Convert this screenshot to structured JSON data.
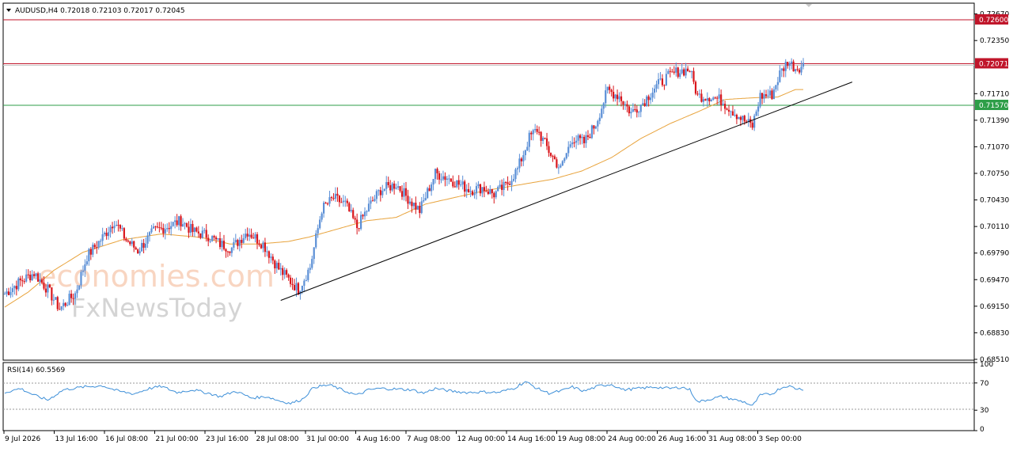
{
  "header": {
    "symbol": "AUDUSD,H4",
    "ohlc": "0.72018 0.72103 0.72017 0.72045"
  },
  "rsi_header": "RSI(14) 60.5569",
  "watermark": {
    "line1": "economies.com",
    "line2": "FxNewsToday"
  },
  "colors": {
    "bull": "#5b8fd6",
    "bear": "#d9161c",
    "ma": "#e8a33c",
    "resistance": "#c0152a",
    "support": "#2e9e48",
    "trendline": "#000000",
    "rsi": "#3d8fd8"
  },
  "chart_data": [
    {
      "type": "candlestick",
      "ylim": [
        0.685,
        0.728
      ],
      "y_ticks": [
        "0.72670",
        "0.72600",
        "0.72350",
        "0.72071",
        "0.71710",
        "0.71570",
        "0.71390",
        "0.71070",
        "0.70750",
        "0.70430",
        "0.70110",
        "0.69790",
        "0.69470",
        "0.69150",
        "0.68830",
        "0.68510"
      ],
      "x_labels": [
        "9 Jul 2026",
        "13 Jul 16:00",
        "16 Jul 08:00",
        "21 Jul 00:00",
        "23 Jul 16:00",
        "28 Jul 08:00",
        "31 Jul 00:00",
        "4 Aug 16:00",
        "7 Aug 08:00",
        "12 Aug 00:00",
        "14 Aug 16:00",
        "19 Aug 08:00",
        "24 Aug 00:00",
        "26 Aug 16:00",
        "31 Aug 08:00",
        "3 Sep 00:00"
      ],
      "levels": [
        {
          "value": 0.726,
          "label": "0.72600",
          "kind": "resistance"
        },
        {
          "value": 0.72071,
          "label": "0.72071",
          "kind": "current"
        },
        {
          "value": 0.7157,
          "label": "0.71570",
          "kind": "support"
        }
      ],
      "trendline": {
        "from": [
          "28 Jul 08:00",
          0.6922
        ],
        "to": [
          "after 3 Sep 00:00",
          0.7185
        ]
      },
      "moving_average_anchors": [
        [
          0,
          0.6914
        ],
        [
          12,
          0.6932
        ],
        [
          25,
          0.6958
        ],
        [
          40,
          0.698
        ],
        [
          60,
          0.6995
        ],
        [
          80,
          0.7002
        ],
        [
          100,
          0.6998
        ],
        [
          115,
          0.699
        ],
        [
          130,
          0.699
        ],
        [
          145,
          0.6993
        ],
        [
          155,
          0.6998
        ],
        [
          170,
          0.7008
        ],
        [
          185,
          0.7018
        ],
        [
          200,
          0.7022
        ],
        [
          215,
          0.7038
        ],
        [
          230,
          0.7046
        ],
        [
          245,
          0.7054
        ],
        [
          260,
          0.706
        ],
        [
          280,
          0.7068
        ],
        [
          295,
          0.7078
        ],
        [
          310,
          0.7094
        ],
        [
          325,
          0.7117
        ],
        [
          340,
          0.7135
        ],
        [
          355,
          0.715
        ],
        [
          368,
          0.7164
        ],
        [
          382,
          0.7166
        ],
        [
          395,
          0.7167
        ],
        [
          404,
          0.7176
        ]
      ],
      "price_anchors": [
        [
          0,
          0.693
        ],
        [
          8,
          0.6945
        ],
        [
          15,
          0.6955
        ],
        [
          22,
          0.6935
        ],
        [
          28,
          0.6912
        ],
        [
          36,
          0.693
        ],
        [
          42,
          0.6975
        ],
        [
          50,
          0.6998
        ],
        [
          56,
          0.7018
        ],
        [
          62,
          0.6995
        ],
        [
          68,
          0.6982
        ],
        [
          76,
          0.7005
        ],
        [
          84,
          0.7012
        ],
        [
          90,
          0.7018
        ],
        [
          96,
          0.7005
        ],
        [
          104,
          0.7
        ],
        [
          110,
          0.699
        ],
        [
          116,
          0.6985
        ],
        [
          124,
          0.7005
        ],
        [
          132,
          0.699
        ],
        [
          140,
          0.696
        ],
        [
          146,
          0.6945
        ],
        [
          150,
          0.6935
        ],
        [
          156,
          0.6962
        ],
        [
          162,
          0.7032
        ],
        [
          168,
          0.7045
        ],
        [
          174,
          0.7038
        ],
        [
          180,
          0.701
        ],
        [
          186,
          0.7035
        ],
        [
          192,
          0.7055
        ],
        [
          200,
          0.7062
        ],
        [
          206,
          0.7045
        ],
        [
          212,
          0.703
        ],
        [
          220,
          0.7075
        ],
        [
          226,
          0.707
        ],
        [
          232,
          0.7062
        ],
        [
          238,
          0.7055
        ],
        [
          244,
          0.7058
        ],
        [
          250,
          0.705
        ],
        [
          256,
          0.706
        ],
        [
          262,
          0.708
        ],
        [
          268,
          0.7118
        ],
        [
          272,
          0.7128
        ],
        [
          278,
          0.7102
        ],
        [
          284,
          0.708
        ],
        [
          290,
          0.7118
        ],
        [
          296,
          0.7112
        ],
        [
          302,
          0.7135
        ],
        [
          308,
          0.7175
        ],
        [
          314,
          0.7168
        ],
        [
          320,
          0.7148
        ],
        [
          326,
          0.716
        ],
        [
          332,
          0.7178
        ],
        [
          338,
          0.719
        ],
        [
          344,
          0.7198
        ],
        [
          350,
          0.72
        ],
        [
          354,
          0.7168
        ],
        [
          360,
          0.7168
        ],
        [
          366,
          0.7163
        ],
        [
          372,
          0.715
        ],
        [
          378,
          0.7138
        ],
        [
          382,
          0.7132
        ],
        [
          386,
          0.7168
        ],
        [
          392,
          0.717
        ],
        [
          396,
          0.7195
        ],
        [
          400,
          0.721
        ],
        [
          404,
          0.7202
        ],
        [
          408,
          0.7205
        ]
      ]
    },
    {
      "type": "line",
      "title": "RSI(14) 60.5569",
      "ylim": [
        0,
        100
      ],
      "y_ticks": [
        "100",
        "70",
        "30",
        "0"
      ],
      "levels": [
        70,
        30
      ],
      "anchors": [
        [
          0,
          56
        ],
        [
          8,
          62
        ],
        [
          15,
          52
        ],
        [
          22,
          45
        ],
        [
          30,
          60
        ],
        [
          40,
          64
        ],
        [
          50,
          66
        ],
        [
          58,
          58
        ],
        [
          66,
          54
        ],
        [
          74,
          62
        ],
        [
          80,
          65
        ],
        [
          88,
          56
        ],
        [
          96,
          60
        ],
        [
          104,
          55
        ],
        [
          110,
          50
        ],
        [
          118,
          58
        ],
        [
          126,
          48
        ],
        [
          134,
          50
        ],
        [
          140,
          44
        ],
        [
          146,
          40
        ],
        [
          152,
          46
        ],
        [
          158,
          64
        ],
        [
          166,
          67
        ],
        [
          174,
          58
        ],
        [
          180,
          52
        ],
        [
          186,
          60
        ],
        [
          192,
          62
        ],
        [
          200,
          61
        ],
        [
          208,
          60
        ],
        [
          214,
          55
        ],
        [
          220,
          62
        ],
        [
          228,
          58
        ],
        [
          236,
          56
        ],
        [
          244,
          57
        ],
        [
          252,
          56
        ],
        [
          260,
          62
        ],
        [
          266,
          72
        ],
        [
          272,
          62
        ],
        [
          278,
          55
        ],
        [
          284,
          58
        ],
        [
          290,
          64
        ],
        [
          296,
          58
        ],
        [
          304,
          66
        ],
        [
          310,
          68
        ],
        [
          316,
          60
        ],
        [
          324,
          62
        ],
        [
          332,
          64
        ],
        [
          340,
          62
        ],
        [
          346,
          64
        ],
        [
          350,
          60
        ],
        [
          354,
          42
        ],
        [
          360,
          46
        ],
        [
          366,
          50
        ],
        [
          372,
          46
        ],
        [
          378,
          42
        ],
        [
          382,
          36
        ],
        [
          386,
          52
        ],
        [
          392,
          54
        ],
        [
          396,
          62
        ],
        [
          400,
          66
        ],
        [
          404,
          62
        ],
        [
          408,
          61
        ]
      ]
    }
  ]
}
